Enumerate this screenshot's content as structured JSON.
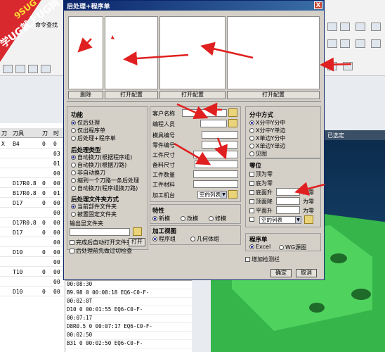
{
  "watermark": {
    "line1": "9SUG",
    "line2": "学UG就上UG网"
  },
  "background": {
    "left_header": [
      "刀",
      "刀具",
      "刀",
      "时"
    ],
    "left_rows": [
      [
        "X",
        "B4",
        "0",
        "0"
      ],
      [
        "",
        "",
        "",
        "03"
      ],
      [
        "",
        "",
        "",
        "01"
      ],
      [
        "",
        "",
        "",
        "00"
      ],
      [
        "",
        "D17R0.8",
        "0",
        "00"
      ],
      [
        "",
        "B17R0.8",
        "0",
        "01"
      ],
      [
        "",
        "D17",
        "0",
        "00"
      ],
      [
        "",
        "",
        "",
        "00"
      ],
      [
        "",
        "D17R0.8",
        "0",
        "00"
      ],
      [
        "",
        "D17",
        "0",
        "00"
      ],
      [
        "",
        "",
        "",
        "00"
      ],
      [
        "",
        "D10",
        "0",
        "00"
      ],
      [
        "",
        "",
        "",
        "00"
      ],
      [
        "",
        "T10",
        "0",
        "00"
      ],
      [
        "",
        "",
        "",
        "00"
      ],
      [
        "",
        "D10",
        "0",
        "00"
      ]
    ],
    "bottom_rows": [
      "00:08:30",
      "B9.98   0  00:08:18  EQ6-C0-F-",
      "            00:02:0T",
      "D10    0  00:01:55  EQ6-C0-F-",
      "            00:07:17",
      "D8R0.5  0  00:07:17  EQ6-C0-F-",
      "            00:02:50",
      "B31    0  00:02:50  EQ6-C0-F-"
    ],
    "right_header": "已选定",
    "toolbar_text": "命令查找"
  },
  "dialog": {
    "title": "后处理+程序单",
    "close": "X",
    "preview_buttons": [
      "删除",
      "打开配置",
      "打开配置",
      "打开配置"
    ],
    "function": {
      "title": "功能",
      "options": [
        "仅后处理",
        "仅出程序单",
        "后处理+程序单"
      ],
      "selected": 0
    },
    "post_type": {
      "title": "后处理类型",
      "options": [
        "自动换刀(根据程序组)",
        "自动换刀(根据刀路)",
        "非自动换刀",
        "缩到一个刀路一条后处理",
        "自动换刀(程序组换刀路)"
      ],
      "selected": 0
    },
    "folder_mode": {
      "title": "后处理文件夹方式",
      "options": [
        "当前部件文件夹",
        "被置固定文件夹"
      ],
      "selected": 0
    },
    "output_folder_label": "输出显文件夹",
    "auto_open_label": "完成后自动打开文件夹",
    "open_button": "打开",
    "precheck_label": "后处理前先做过切检查",
    "fields": {
      "customer": "客户名称",
      "programmer": "编程人员",
      "mold_no": "模具编号",
      "part_no": "零件编号",
      "work_size": "工件尺寸",
      "stock_size": "备料尺寸",
      "work_qty": "工件数量",
      "work_material": "工件材料",
      "machine": "加工机台",
      "machine_value": "空的列表"
    },
    "property": {
      "title": "特性",
      "options": [
        "新模",
        "改模",
        "修模"
      ],
      "selected": 0
    },
    "view": {
      "title": "加工视图",
      "options": [
        "程序组",
        "几何体组"
      ],
      "selected": 0
    },
    "split": {
      "title": "分中方式",
      "options": [
        "X分中Y分中",
        "X分中Y单边",
        "X单边Y分中",
        "X单边Y单边",
        "见图"
      ],
      "selected": 0
    },
    "zero": {
      "title": "零位",
      "items": [
        "顶为零",
        "底为零",
        "底面升",
        "顶面降",
        "平面升"
      ],
      "unit_labels": [
        "为零",
        "为零",
        "为零"
      ],
      "combo_value": "空的列表"
    },
    "sheet": {
      "title": "程序单",
      "options": [
        "Excel",
        "WG源图"
      ],
      "selected": 0
    },
    "add_check_label": "增加检测栏",
    "ok_button": "确定",
    "cancel_button": "取消"
  }
}
